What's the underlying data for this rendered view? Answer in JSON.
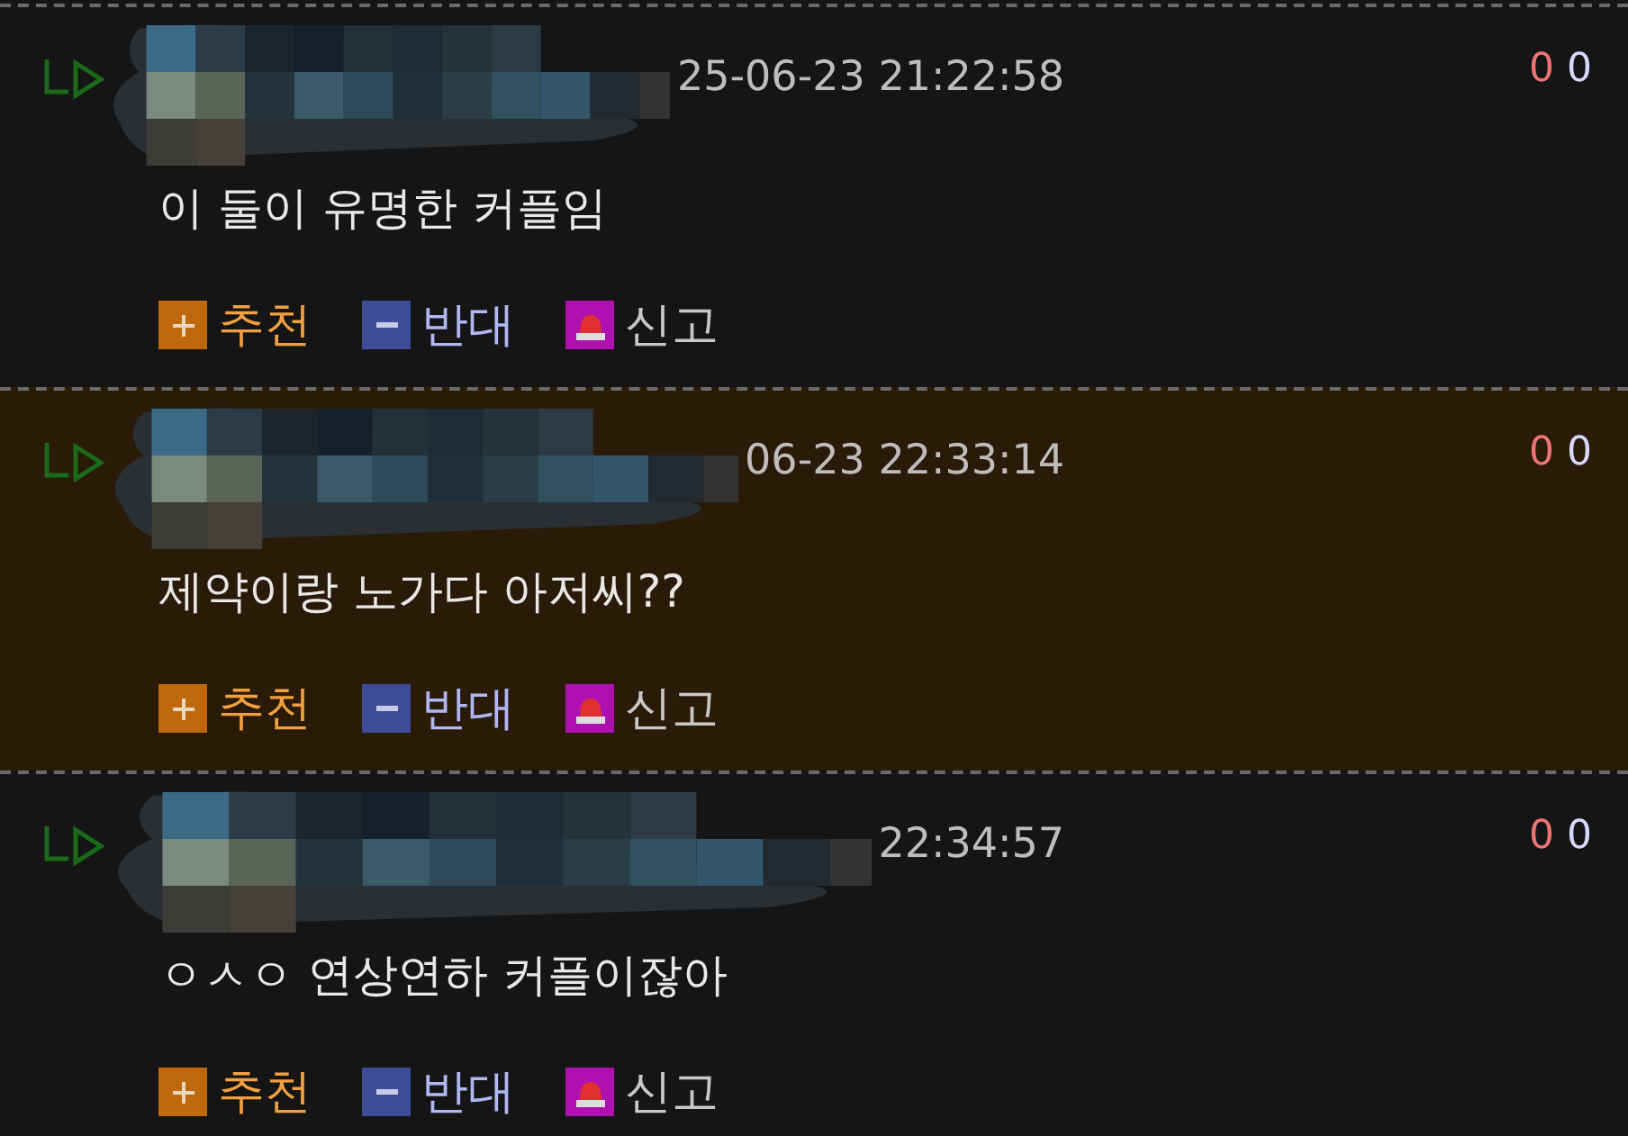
{
  "comments": [
    {
      "highlighted": false,
      "date": "25-06-23 21:22:58",
      "up_count": "0",
      "down_count": "0",
      "text": "이 둘이 유명한 커플임",
      "actions": [
        "추천",
        "반대",
        "신고"
      ]
    },
    {
      "highlighted": true,
      "date": "06-23 22:33:14",
      "up_count": "0",
      "down_count": "0",
      "text": "제약이랑 노가다 아저씨??",
      "actions": [
        "추천",
        "반대",
        "신고"
      ]
    },
    {
      "highlighted": false,
      "date": "22:34:57",
      "up_count": "0",
      "down_count": "0",
      "text": "ㅇㅅㅇ 연상연하 커플이잖아",
      "actions": [
        "추천",
        "반대",
        "신고"
      ]
    }
  ]
}
